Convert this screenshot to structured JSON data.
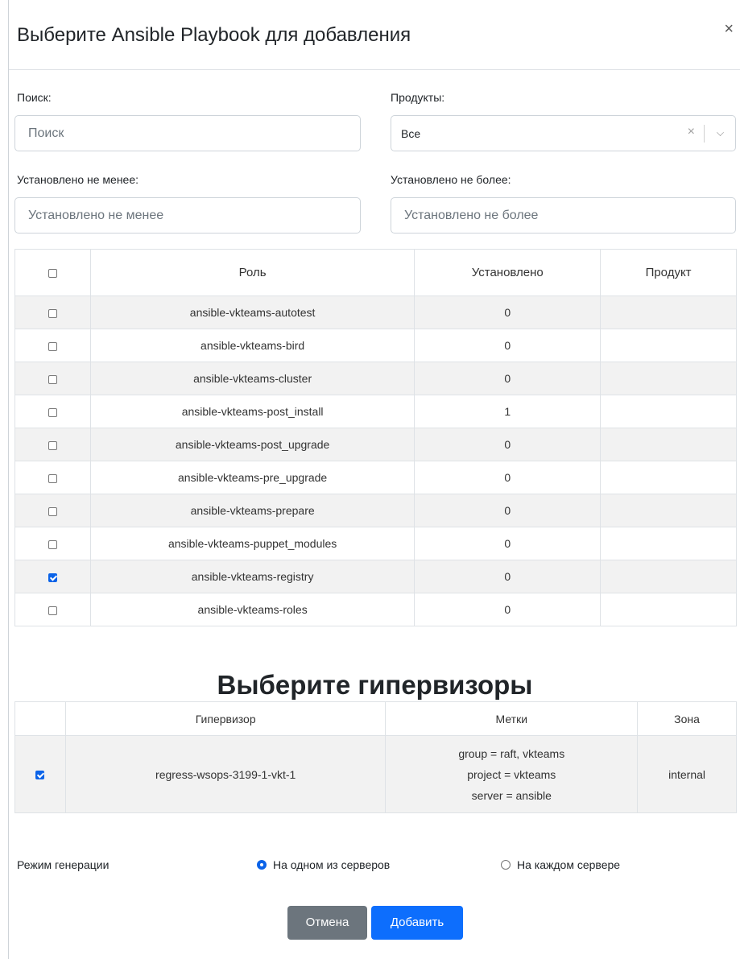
{
  "dialog": {
    "title": "Выберите Ansible Playbook для добавления",
    "close_icon": "×"
  },
  "filters": {
    "search_label": "Поиск:",
    "search_placeholder": "Поиск",
    "products_label": "Продукты:",
    "products_value": "Все",
    "min_label": "Установлено не менее:",
    "min_placeholder": "Установлено не менее",
    "max_label": "Установлено не более:",
    "max_placeholder": "Установлено не более"
  },
  "roles_table": {
    "headers": [
      "Роль",
      "Установлено",
      "Продукт"
    ],
    "rows": [
      {
        "checked": false,
        "role": "ansible-vkteams-autotest",
        "installed": "0",
        "product": ""
      },
      {
        "checked": false,
        "role": "ansible-vkteams-bird",
        "installed": "0",
        "product": ""
      },
      {
        "checked": false,
        "role": "ansible-vkteams-cluster",
        "installed": "0",
        "product": ""
      },
      {
        "checked": false,
        "role": "ansible-vkteams-post_install",
        "installed": "1",
        "product": ""
      },
      {
        "checked": false,
        "role": "ansible-vkteams-post_upgrade",
        "installed": "0",
        "product": ""
      },
      {
        "checked": false,
        "role": "ansible-vkteams-pre_upgrade",
        "installed": "0",
        "product": ""
      },
      {
        "checked": false,
        "role": "ansible-vkteams-prepare",
        "installed": "0",
        "product": ""
      },
      {
        "checked": false,
        "role": "ansible-vkteams-puppet_modules",
        "installed": "0",
        "product": ""
      },
      {
        "checked": true,
        "role": "ansible-vkteams-registry",
        "installed": "0",
        "product": ""
      },
      {
        "checked": false,
        "role": "ansible-vkteams-roles",
        "installed": "0",
        "product": ""
      }
    ]
  },
  "hypervisors": {
    "title": "Выберите гипервизоры",
    "headers": [
      "Гипервизор",
      "Метки",
      "Зона"
    ],
    "rows": [
      {
        "checked": true,
        "name": "regress-wsops-3199-1-vkt-1",
        "labels": [
          "group = raft, vkteams",
          "project = vkteams",
          "server = ansible"
        ],
        "zone": "internal"
      }
    ]
  },
  "generation_mode": {
    "label": "Режим генерации",
    "options": [
      {
        "label": "На одном из серверов",
        "selected": true
      },
      {
        "label": "На каждом сервере",
        "selected": false
      }
    ]
  },
  "buttons": {
    "cancel": "Отмена",
    "add": "Добавить"
  },
  "colors": {
    "primary": "#0d6efd",
    "secondary": "#6c757d",
    "stripe": "#f2f2f2"
  }
}
